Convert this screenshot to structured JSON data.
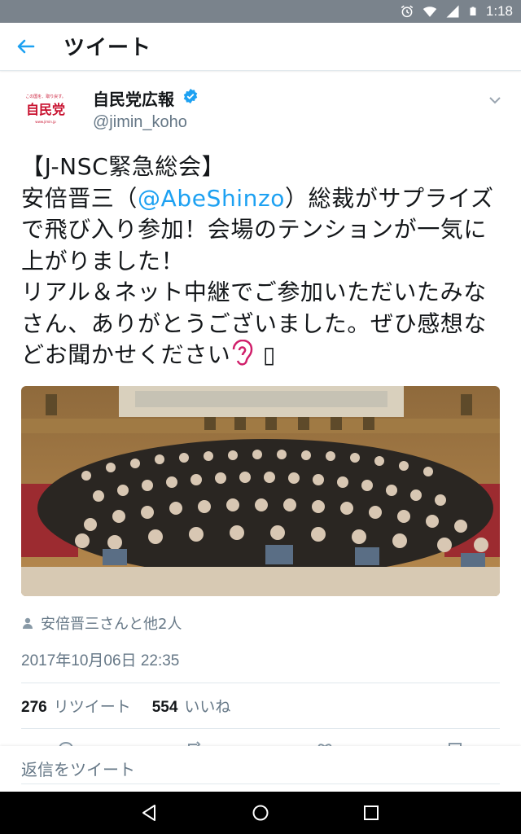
{
  "status_bar": {
    "time": "1:18"
  },
  "header": {
    "title": "ツイート"
  },
  "tweet": {
    "author": {
      "name": "自民党広報",
      "handle": "@jimin_koho",
      "avatar_text": "自民党"
    },
    "text_before": "【J-NSC緊急総会】\n安倍晋三（",
    "mention": "@AbeShinzo",
    "text_after": "）総裁がサプライズで飛び入り参加！会場のテンションが一気に上がりました！\nリアル＆ネット中継でご参加いただいたみなさん、ありがとうございました。ぜひ感想などお聞かせください",
    "text_trailing": " ▯",
    "tagged": "安倍晋三さんと他2人",
    "timestamp": "2017年10月06日 22:35",
    "retweets": {
      "count": "276",
      "label": "リツイート"
    },
    "likes": {
      "count": "554",
      "label": "いいね"
    }
  },
  "reply": {
    "placeholder": "返信をツイート"
  },
  "colors": {
    "accent": "#1da1f2",
    "status_bar": "#7a838c",
    "secondary_text": "#657786"
  }
}
